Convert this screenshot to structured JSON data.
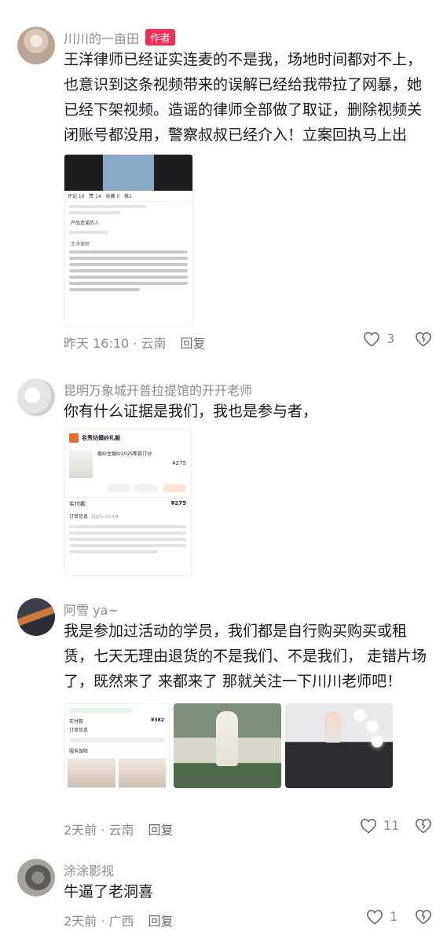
{
  "comments": [
    {
      "username": "川川的一亩田",
      "badge": "作者",
      "text": "王洋律师已经证实连麦的不是我，场地时间都对不上，也意识到这条视频带来的误解已经给我带拉了网暴，她已经下架视频。造谣的律师全部做了取证，删除视频关闭账号都没用，警察叔叔已经介入！立案回执马上出",
      "time_location": "昨天 16:10 · 云南",
      "reply_label": "回复",
      "likes": "3",
      "image": {
        "tab_comments": "评论 10",
        "tab_likes": "赞 14",
        "tab_collect": "收藏 0",
        "tab_forward": "推1",
        "line1": "产品造谣的人",
        "lawyer_name": "王洋律师"
      }
    },
    {
      "username": "昆明万象城开普拉提馆的开开老师",
      "text": "你有什么证据是我们，我也是参与者，",
      "image": {
        "shop": "名秀坊婚纱礼服",
        "product": "婚纱主婚纱2025新款订纱",
        "price": "¥275",
        "paid_label": "实付款",
        "paid": "¥275",
        "order_info": "订单信息",
        "order_date": "2025-10-04",
        "btn_1": "闲鱼转卖",
        "btn_2": "申请售后",
        "btn_3": "加入购物车"
      }
    },
    {
      "username": "阿雪 ya~",
      "text": "我是参加过活动的学员，我们都是自行购买购买或租赁，七天无理由退货的不是我们、不是我们， 走错片场了，既然来了 来都来了 那就关注一下川川老师吧！",
      "time_location": "2天前 · 云南",
      "reply_label": "回复",
      "likes": "11",
      "image": {
        "price": "¥382",
        "paid_label": "实付款",
        "order_info": "订单信息",
        "service": "服务保障"
      }
    },
    {
      "username": "涂涂影视",
      "text": "牛逼了老洞喜",
      "time_location": "2天前 · 广西",
      "reply_label": "回复",
      "likes": "1"
    }
  ],
  "colors": {
    "badge": "#fe2c55",
    "meta": "#8a8b91",
    "text": "#161823"
  },
  "icons": [
    "heart-outline-icon",
    "broken-heart-icon"
  ]
}
